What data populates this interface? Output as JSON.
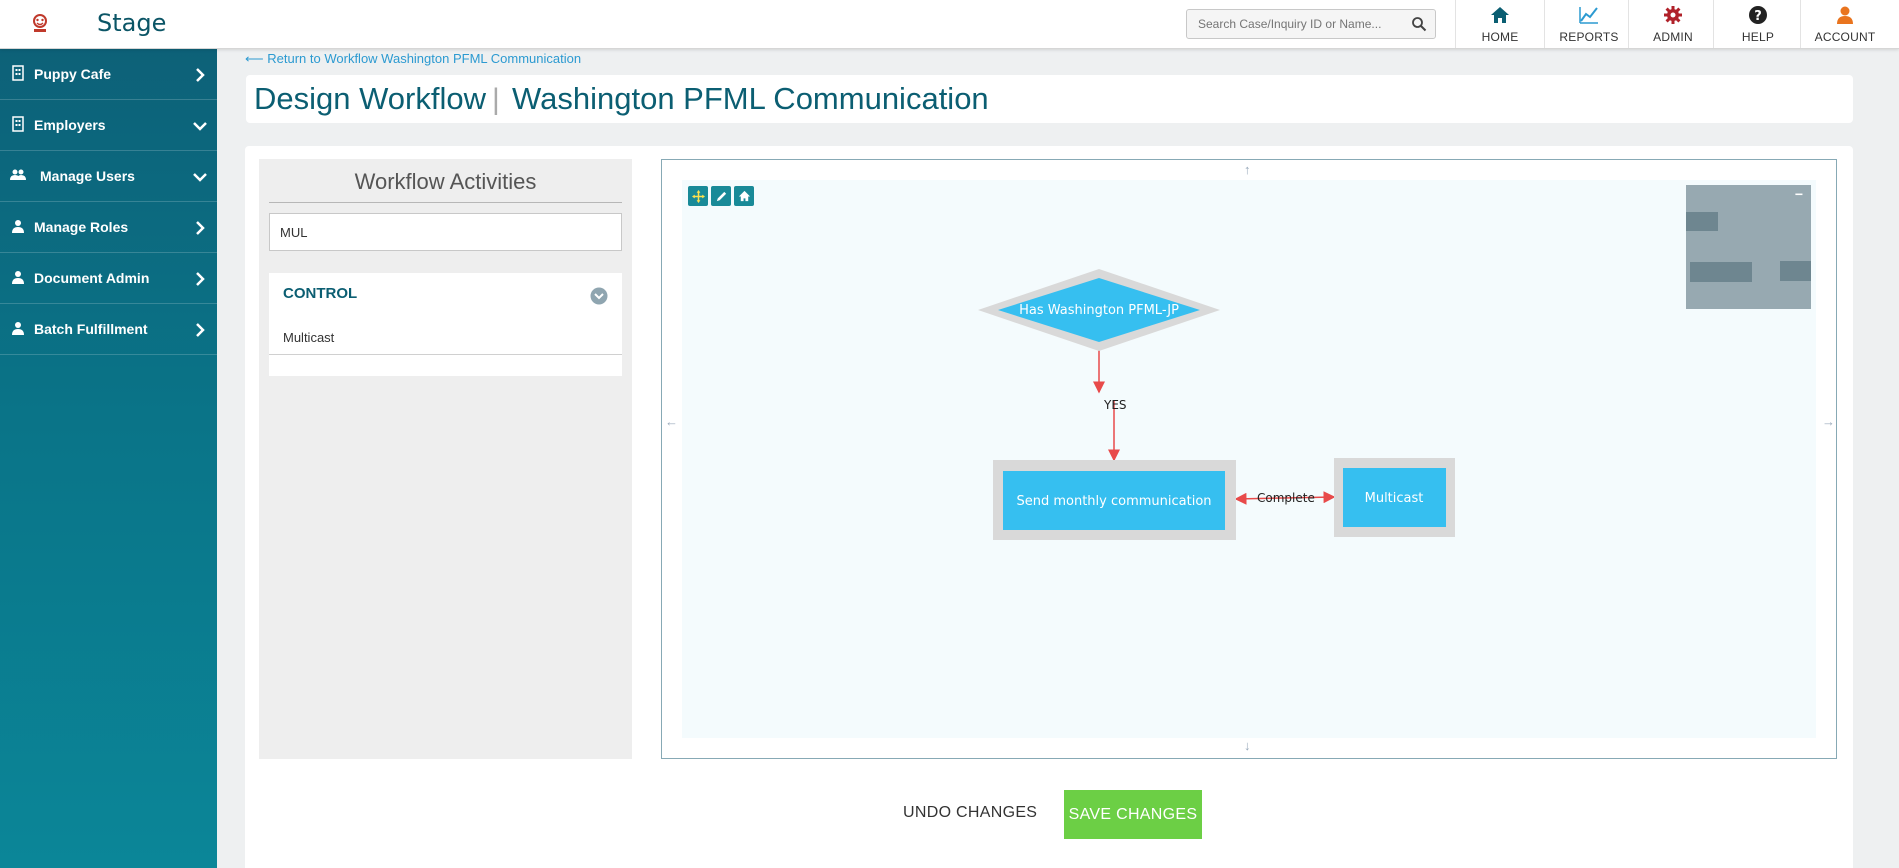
{
  "header": {
    "brand": "Stage",
    "search_placeholder": "Search Case/Inquiry ID or Name...",
    "nav": [
      {
        "label": "HOME",
        "icon": "home-icon",
        "color": "#0b5e72"
      },
      {
        "label": "REPORTS",
        "icon": "chart-line-icon",
        "color": "#2c9ad1"
      },
      {
        "label": "ADMIN",
        "icon": "gear-icon",
        "color": "#b0212a"
      },
      {
        "label": "HELP",
        "icon": "question-icon",
        "color": "#222222"
      },
      {
        "label": "ACCOUNT",
        "icon": "user-icon",
        "color": "#e9741e"
      }
    ]
  },
  "sidebar": {
    "items": [
      {
        "label": "Puppy Cafe",
        "icon": "building-icon",
        "chevron": "right"
      },
      {
        "label": "Employers",
        "icon": "building-icon",
        "chevron": "down"
      },
      {
        "label": "Manage Users",
        "icon": "users-icon",
        "chevron": "down"
      },
      {
        "label": "Manage Roles",
        "icon": "user-icon",
        "chevron": "right"
      },
      {
        "label": "Document Admin",
        "icon": "user-icon",
        "chevron": "right"
      },
      {
        "label": "Batch Fulfillment",
        "icon": "user-icon",
        "chevron": "right"
      }
    ]
  },
  "page": {
    "back_link": "Return to Workflow Washington PFML Communication",
    "title_left": "Design Workflow",
    "title_right": "Washington PFML Communication"
  },
  "activities": {
    "heading": "Workflow Activities",
    "filter_value": "MUL",
    "category": "CONTROL",
    "items": [
      "Multicast"
    ]
  },
  "workflow": {
    "nodes": {
      "decision": "Has Washington PFML-JP",
      "send": "Send monthly communication",
      "multicast": "Multicast"
    },
    "edges": {
      "yes": "YES",
      "complete": "Complete"
    },
    "colors": {
      "node": "#36bff0",
      "edge": "#e84a4a",
      "node_border": "#d9d9d9"
    }
  },
  "actions": {
    "undo": "UNDO CHANGES",
    "save": "SAVE CHANGES"
  }
}
